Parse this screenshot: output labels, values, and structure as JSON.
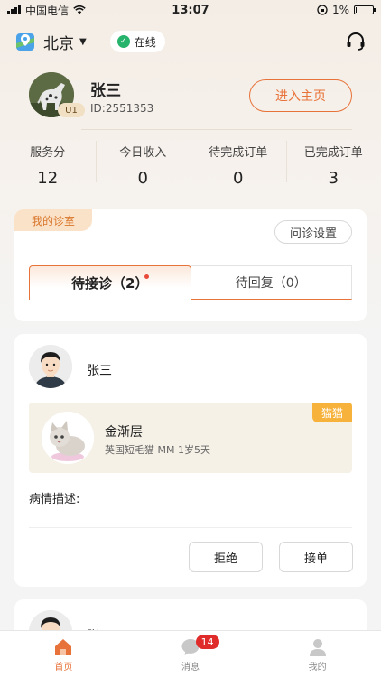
{
  "status_bar": {
    "carrier": "中国电信",
    "time": "13:07",
    "battery": "1%"
  },
  "header": {
    "city": "北京",
    "online_status": "在线"
  },
  "profile": {
    "name": "张三",
    "id_text": "ID:2551353",
    "level": "U1",
    "home_button": "进入主页"
  },
  "stats": [
    {
      "label": "服务分",
      "value": "12"
    },
    {
      "label": "今日收入",
      "value": "0"
    },
    {
      "label": "待完成订单",
      "value": "0"
    },
    {
      "label": "已完成订单",
      "value": "3"
    }
  ],
  "clinic": {
    "tag": "我的诊室",
    "settings_button": "问诊设置",
    "tabs": [
      {
        "label": "待接诊（2）",
        "active": true
      },
      {
        "label": "待回复（0）",
        "active": false
      }
    ]
  },
  "order": {
    "owner_name": "张三",
    "pet_name": "金渐层",
    "pet_info": "英国短毛猫 MM 1岁5天",
    "pet_type": "猫猫",
    "description_label": "病情描述:",
    "reject_button": "拒绝",
    "accept_button": "接单"
  },
  "next_order": {
    "owner_name": "张三"
  },
  "tabbar": {
    "items": [
      {
        "label": "首页",
        "active": true
      },
      {
        "label": "消息",
        "badge": "14"
      },
      {
        "label": "我的"
      }
    ]
  },
  "colors": {
    "accent": "#e8733a",
    "online": "#26b36b",
    "badge": "#e02b2b",
    "pet_tag": "#f7b23b"
  }
}
